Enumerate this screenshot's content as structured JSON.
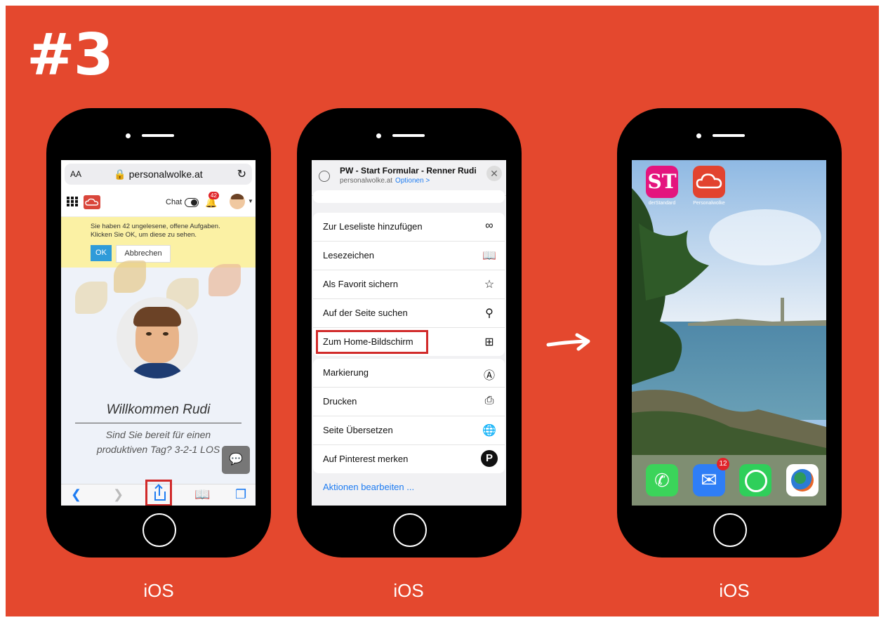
{
  "step_label": "#3",
  "captions": [
    "iOS",
    "iOS",
    "iOS"
  ],
  "phone1": {
    "url_aa": "AA",
    "url_host": "personalwolke.at",
    "chat_label": "Chat",
    "notification_count": "42",
    "alert_line1": "Sie haben 42 ungelesene, offene Aufgaben.",
    "alert_line2": "Klicken Sie OK, um diese zu sehen.",
    "ok_label": "OK",
    "cancel_label": "Abbrechen",
    "welcome": "Willkommen  Rudi",
    "ready_line1": "Sind Sie bereit für einen",
    "ready_line2": "produktiven Tag? 3-2-1 LOS"
  },
  "phone2": {
    "title": "PW - Start Formular - Renner Rudi",
    "subtitle": "personalwolke.at",
    "options": "Optionen >",
    "group1": [
      {
        "label": "Zur Leseliste hinzufügen",
        "icon": "glasses-icon"
      },
      {
        "label": "Lesezeichen",
        "icon": "book-icon"
      },
      {
        "label": "Als Favorit sichern",
        "icon": "star-icon"
      },
      {
        "label": "Auf der Seite suchen",
        "icon": "search-icon"
      },
      {
        "label": "Zum Home-Bildschirm",
        "icon": "plus-square-icon"
      }
    ],
    "group2": [
      {
        "label": "Markierung",
        "icon": "markup-icon"
      },
      {
        "label": "Drucken",
        "icon": "printer-icon"
      },
      {
        "label": "Seite Übersetzen",
        "icon": "globe-icon"
      },
      {
        "label": "Auf Pinterest merken",
        "icon": "pinterest-icon"
      }
    ],
    "edit_actions": "Aktionen bearbeiten ..."
  },
  "phone3": {
    "apps": [
      {
        "label": "derStandard",
        "glyph": "ST",
        "color": "#e4157e"
      },
      {
        "label": "Personalwolke",
        "glyph": "",
        "color": "#e2432f"
      }
    ],
    "mail_badge": "12"
  },
  "colors": {
    "background": "#e4482e",
    "highlight": "#d12a2a",
    "ios_blue": "#1e7cf2"
  }
}
